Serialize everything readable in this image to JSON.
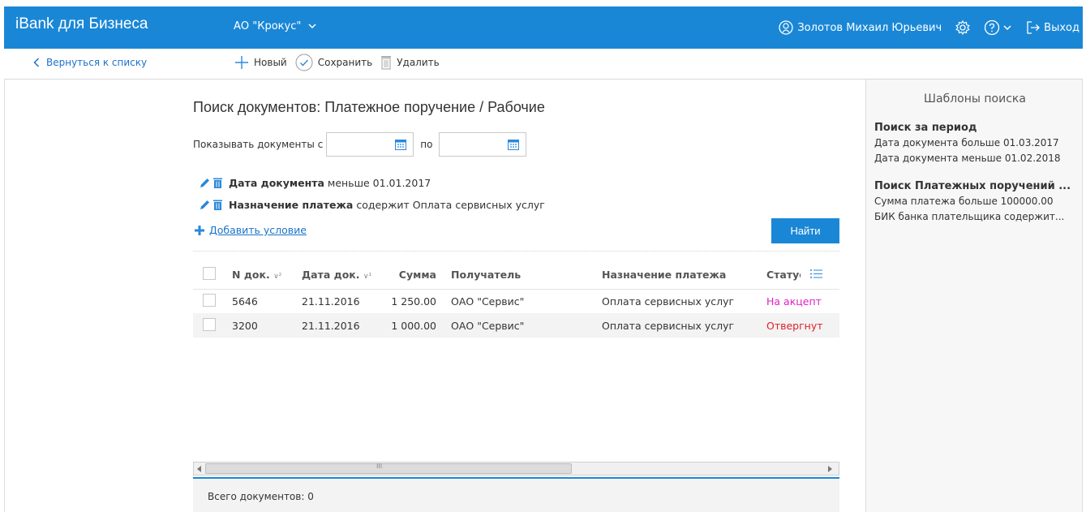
{
  "header": {
    "brand": "iBank для Бизнеса",
    "org": "АО \"Крокус\"",
    "user": "Золотов Михаил Юрьевич",
    "logout": "Выход"
  },
  "toolbar": {
    "back": "Вернуться к списку",
    "new": "Новый",
    "save": "Сохранить",
    "delete": "Удалить"
  },
  "search": {
    "title": "Поиск документов: Платежное поручение / Рабочие",
    "show_label": "Показывать документы с",
    "to_label": "по",
    "date_from": "",
    "date_to": "",
    "conditions": [
      {
        "field": "Дата документа",
        "text": " меньше 01.01.2017"
      },
      {
        "field": "Назначение платежа",
        "text": " содержит Оплата сервисных услуг"
      }
    ],
    "add_condition": "Добавить условие",
    "find": "Найти"
  },
  "table": {
    "columns": [
      "N док.",
      "Дата док.",
      "Сумма",
      "Получатель",
      "Назначение платежа",
      "Статус"
    ],
    "sort_marks": [
      "∨²",
      "∨¹"
    ],
    "rows": [
      {
        "num": "5646",
        "date": "21.11.2016",
        "sum": "1 250.00",
        "recipient": "ОАО \"Сервис\"",
        "purpose": "Оплата сервисных услуг",
        "status": "На акцепт",
        "status_color": "#e020c8"
      },
      {
        "num": "3200",
        "date": "21.11.2016",
        "sum": "1 000.00",
        "recipient": "ОАО \"Сервис\"",
        "purpose": "Оплата сервисных услуг",
        "status": "Отвергнут",
        "status_color": "#e0202a"
      }
    ],
    "scroll_mark": "III"
  },
  "footer": {
    "total": "Всего документов: 0"
  },
  "templates": {
    "title": "Шаблоны поиска",
    "groups": [
      {
        "name": "Поиск за период",
        "lines": [
          "Дата документа больше 01.03.2017",
          "Дата документа меньше 01.02.2018"
        ]
      },
      {
        "name": "Поиск Платежных поручений ...",
        "lines": [
          "Сумма платежа больше 100000.00",
          "БИК банка плательщика содержит..."
        ]
      }
    ]
  },
  "colors": {
    "accent": "#1a87d6",
    "link": "#1a73c8"
  }
}
